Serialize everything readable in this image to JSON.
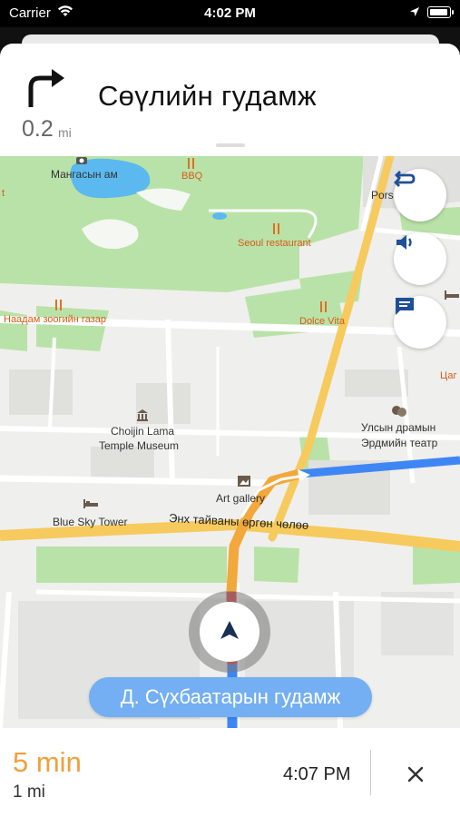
{
  "status_bar": {
    "carrier": "Carrier",
    "time": "4:02 PM"
  },
  "instruction": {
    "distance_value": "0.2",
    "distance_unit": "mi",
    "street": "Сөүлийн гудамж",
    "maneuver_icon": "turn-right-icon"
  },
  "map": {
    "labels": {
      "mangasyn": "Мангасын ам",
      "bbq": "BBQ",
      "seoul": "Seoul restaurant",
      "porsche": "Pors",
      "naadam": "Наадам зоогийн газар",
      "dolce": "Dolce Vita",
      "choijin1": "Choijin Lama",
      "choijin2": "Temple Museum",
      "theatre1": "Улсын драмын",
      "theatre2": "Эрдмийн театр",
      "art": "Art gallery",
      "bluesky": "Blue Sky Tower",
      "peace_ave": "Энх тайваны өргөн чөлөө",
      "edge_t": "t",
      "edge_tsag": "Цаг"
    },
    "buttons": {
      "routes_icon": "routes-icon",
      "sound_icon": "speaker-icon",
      "report_icon": "message-icon"
    },
    "destination_street": "Д. Сүхбаатарын гудамж"
  },
  "trip": {
    "duration": "5 min",
    "distance": "1 mi",
    "eta": "4:07 PM"
  },
  "colors": {
    "route_blue": "#3f86f5",
    "route_orange": "#f2a83b",
    "route_red": "#e03c3c",
    "park_green": "#b9e2a8",
    "water": "#5bb9f0",
    "road_yellow": "#f7ca5e"
  }
}
